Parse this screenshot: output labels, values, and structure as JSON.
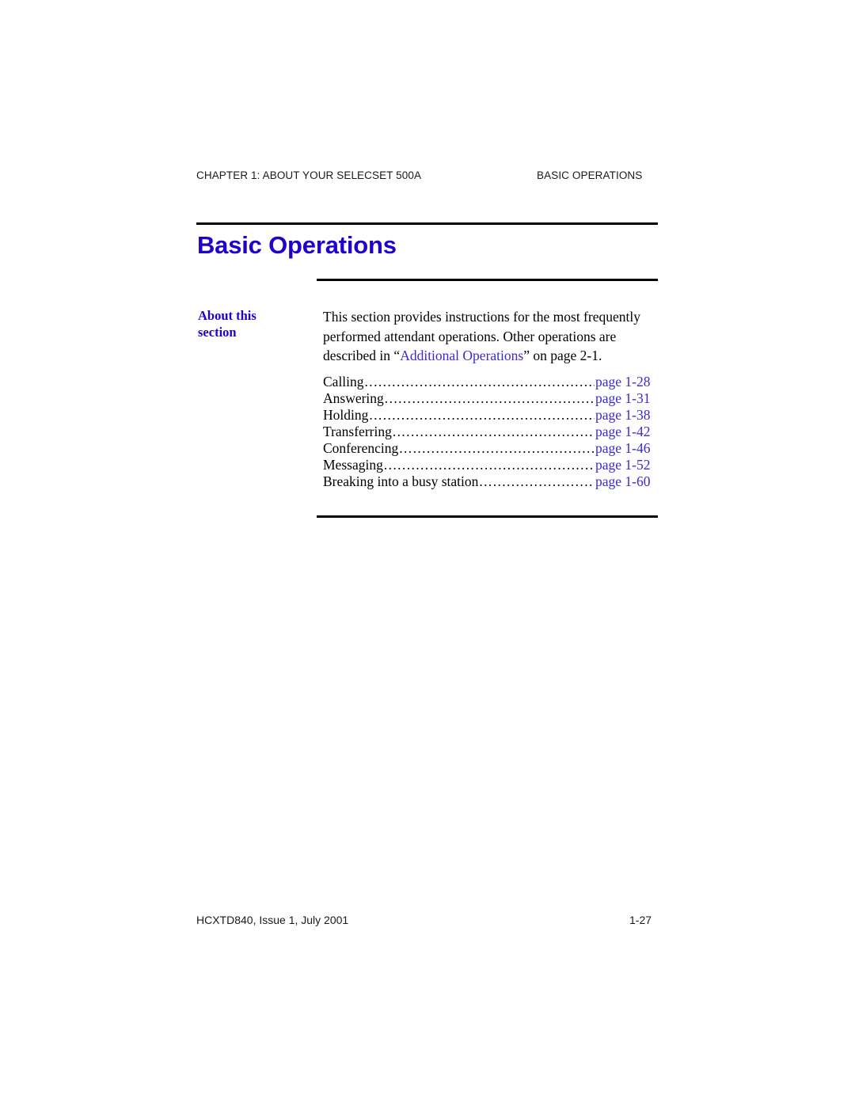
{
  "colors": {
    "heading_blue": "#2200CC",
    "link_blue": "#3A2ACF",
    "rule_black": "#000000",
    "text_black": "#000000",
    "page_background": "#FFFFFF"
  },
  "header": {
    "left": "CHAPTER 1: ABOUT YOUR SELECSET 500A",
    "right": "BASIC OPERATIONS"
  },
  "title": "Basic Operations",
  "side_label": {
    "line1": "About this",
    "line2": "section"
  },
  "intro": {
    "before_link": "This section provides instructions for the most frequently performed attendant operations. Other operations are described in “",
    "link": "Additional Operations",
    "after_link": "” on page 2-1."
  },
  "toc": {
    "items": [
      {
        "label": "Calling",
        "page": "page 1-28"
      },
      {
        "label": "Answering",
        "page": "page 1-31"
      },
      {
        "label": "Holding",
        "page": "page 1-38"
      },
      {
        "label": "Transferring",
        "page": "page 1-42"
      },
      {
        "label": "Conferencing",
        "page": "page 1-46"
      },
      {
        "label": "Messaging",
        "page": "page 1-52"
      },
      {
        "label": "Breaking into a busy station",
        "page": "page 1-60"
      }
    ]
  },
  "footer": {
    "left": "HCXTD840, Issue 1, July 2001",
    "right": "1-27"
  }
}
